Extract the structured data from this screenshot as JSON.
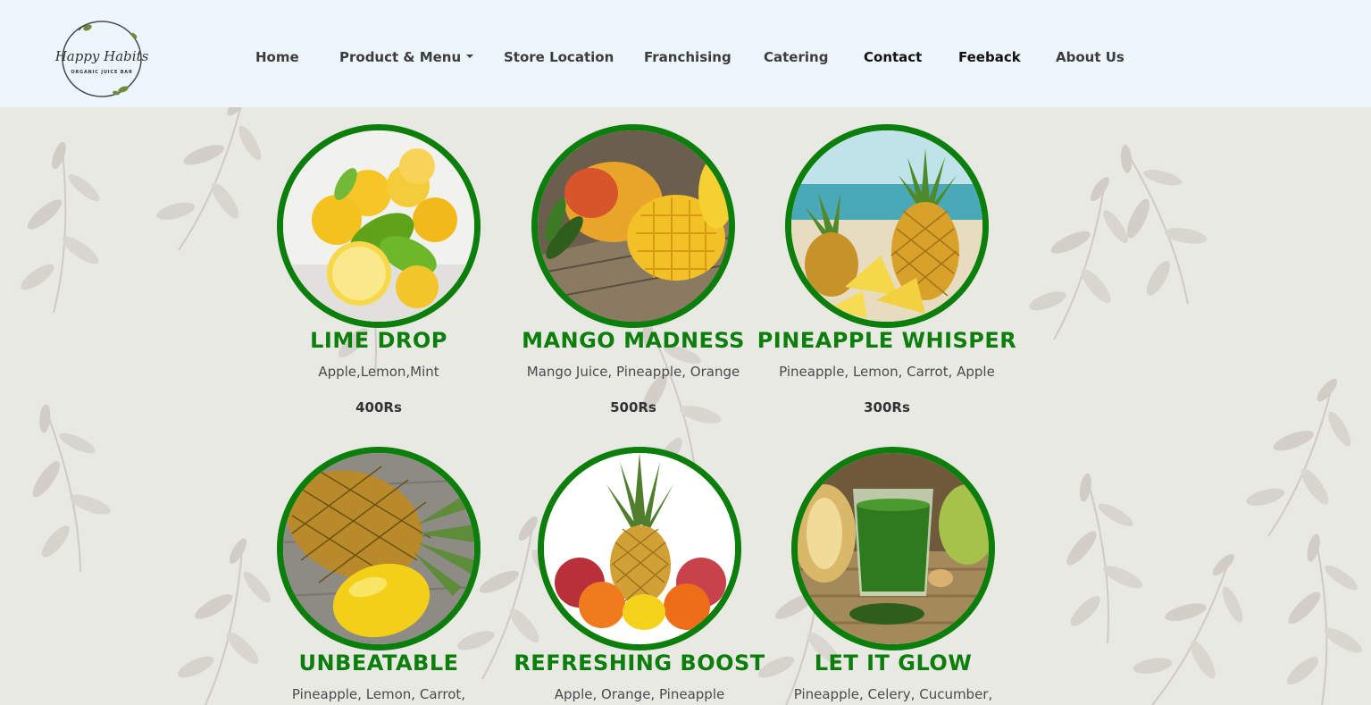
{
  "brand": {
    "logo_line1": "Happy Habits",
    "logo_line2": "ORGANIC JUICE BAR"
  },
  "nav": {
    "home": "Home",
    "products": "Product & Menu",
    "store": "Store Location",
    "franchising": "Franchising",
    "catering": "Catering",
    "contact": "Contact",
    "feedback": "Feeback",
    "about": "About Us"
  },
  "colors": {
    "accent_green": "#0b7e0b",
    "nav_bg": "#eef6fd",
    "page_bg": "#e9e9e4"
  },
  "products": [
    {
      "title": "LIME DROP",
      "ingredients": "Apple,Lemon,Mint",
      "price": "400Rs",
      "image": "lemons-image"
    },
    {
      "title": "MANGO MADNESS",
      "ingredients": "Mango Juice, Pineapple, Orange",
      "price": "500Rs",
      "image": "mango-image"
    },
    {
      "title": "PINEAPPLE WHISPER",
      "ingredients": "Pineapple, Lemon, Carrot, Apple",
      "price": "300Rs",
      "image": "pineapple-image"
    },
    {
      "title": "UNBEATABLE",
      "ingredients": "Pineapple, Lemon, Carrot,",
      "price": "",
      "image": "pineapple-lemon-image"
    },
    {
      "title": "REFRESHING BOOST",
      "ingredients": "Apple, Orange, Pineapple",
      "price": "",
      "image": "mixed-fruit-image"
    },
    {
      "title": "LET IT GLOW",
      "ingredients": "Pineapple, Celery, Cucumber,",
      "price": "",
      "image": "green-juice-image"
    }
  ]
}
